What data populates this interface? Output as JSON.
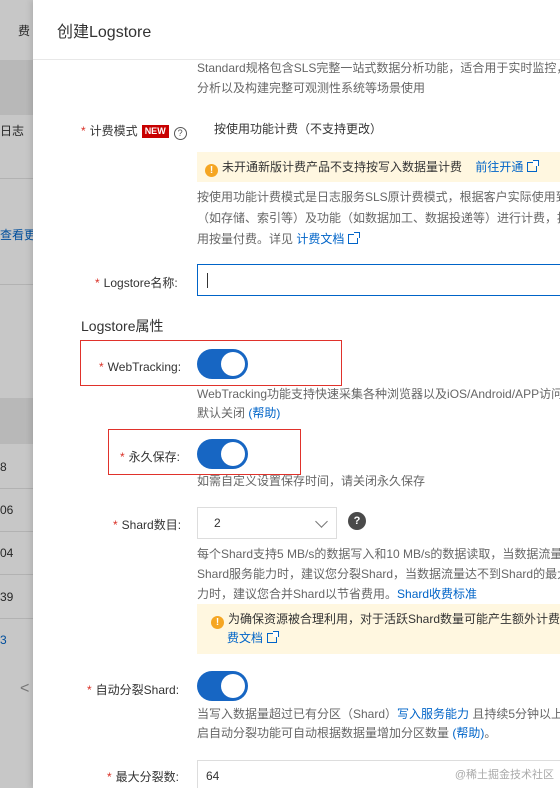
{
  "background": {
    "tab_fragment": "费",
    "item_log": "日志",
    "item_more": "查看更",
    "row_values": [
      "8",
      "06",
      "04",
      "39",
      "3"
    ],
    "prev_arrow": "<"
  },
  "drawer": {
    "title": "创建Logstore",
    "standard_desc_line1": "Standard规格包含SLS完整一站式数据分析功能，适合用于实时监控，",
    "standard_desc_line2": "分析以及构建完整可观测性系统等场景使用",
    "billing": {
      "label": "计费模式",
      "new_badge": "NEW",
      "help": "?",
      "value": "按使用功能计费（不支持更改）",
      "notice_text": "未开通新版计费产品不支持按写入数据量计费",
      "notice_link": "前往开通",
      "desc_line1": "按使用功能计费模式是日志服务SLS原计费模式，根据客户实际使用到",
      "desc_line2": "（如存储、索引等）及功能（如数据加工、数据投递等）进行计费，按",
      "desc_line3_prefix": "用按量付费。详见",
      "desc_line3_link": "计费文档"
    },
    "logstore_name": {
      "label": "Logstore名称:",
      "value": ""
    },
    "attributes_title": "Logstore属性",
    "webtracking": {
      "label": "WebTracking:",
      "enabled": true,
      "desc_line1": "WebTracking功能支持快速采集各种浏览器以及iOS/Android/APP访问",
      "desc_line2_prefix": "默认关闭",
      "desc_line2_link": "(帮助)"
    },
    "permanent": {
      "label": "永久保存:",
      "enabled": true,
      "desc": "如需自定义设置保存时间，请关闭永久保存"
    },
    "shard": {
      "label": "Shard数目:",
      "value": "2",
      "help": "?",
      "desc_line1": "每个Shard支持5 MB/s的数据写入和10 MB/s的数据读取，当数据流量",
      "desc_line2": "Shard服务能力时，建议您分裂Shard，当数据流量达不到Shard的最大",
      "desc_line3_prefix": "力时，建议您合并Shard以节省费用。",
      "desc_line3_link": "Shard收费标准",
      "notice_line1": "为确保资源被合理利用，对于活跃Shard数量可能产生额外计费",
      "notice_line2_link": "费文档"
    },
    "auto_split": {
      "label": "自动分裂Shard:",
      "enabled": true,
      "desc_line1_prefix": "当写入数据量超过已有分区（Shard）",
      "desc_line1_link": "写入服务能力",
      "desc_line1_suffix": " 且持续5分钟以上",
      "desc_line2_prefix": "启自动分裂功能可自动根据数据量增加分区数量",
      "desc_line2_link": "(帮助)",
      "desc_line2_suffix": "。"
    },
    "max_split": {
      "label": "最大分裂数:",
      "value": "64"
    }
  },
  "watermark": "@稀土掘金技术社区"
}
